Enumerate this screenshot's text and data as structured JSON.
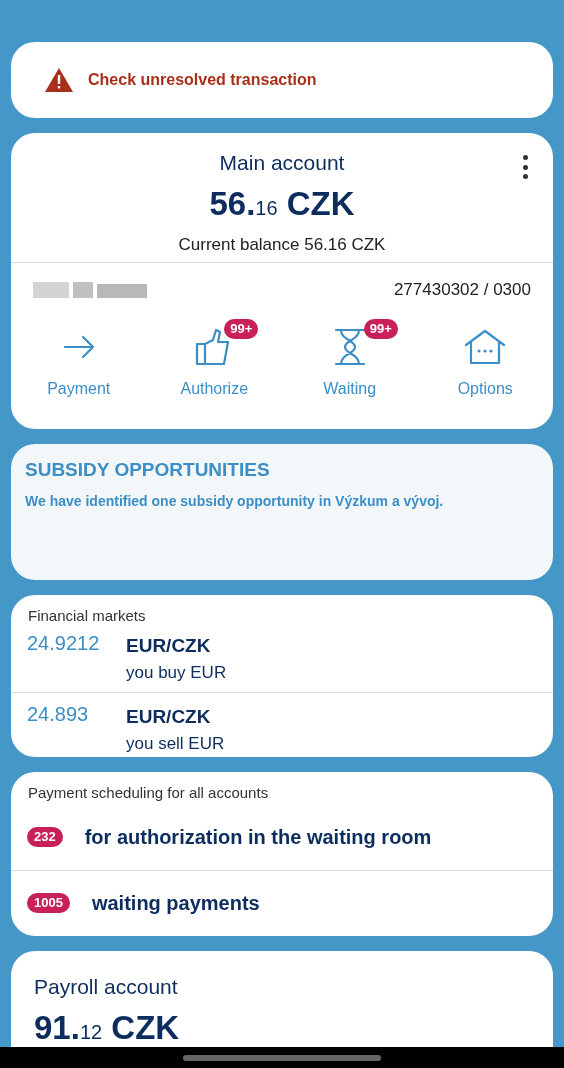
{
  "alert": {
    "text": "Check unresolved transaction"
  },
  "main_account": {
    "name": "Main account",
    "amount": {
      "whole": "56.",
      "fraction": "16",
      "currency": "CZK"
    },
    "balance": "Current balance 56.16 CZK",
    "number": "277430302 / 0300",
    "actions": [
      {
        "kind": "arrow",
        "label": "Payment"
      },
      {
        "kind": "thumb",
        "label": "Authorize",
        "badge": "99+"
      },
      {
        "kind": "hourglass",
        "label": "Waiting",
        "badge": "99+"
      },
      {
        "kind": "house",
        "label": "Options"
      }
    ]
  },
  "subsidy": {
    "title": "SUBSIDY OPPORTUNITIES",
    "text": "We have identified one subsidy opportunity in Výzkum a vývoj."
  },
  "financial_markets": {
    "title": "Financial markets",
    "rates": [
      {
        "rate": "24.9212",
        "pair": "EUR/CZK",
        "note": "you buy EUR"
      },
      {
        "rate": "24.893",
        "pair": "EUR/CZK",
        "note": "you sell EUR"
      }
    ]
  },
  "payment_scheduling": {
    "title": "Payment scheduling for all accounts",
    "items": [
      {
        "count": "232",
        "text": "for authorization in the waiting room"
      },
      {
        "count": "1005",
        "text": "waiting payments"
      }
    ]
  },
  "payroll_account": {
    "name": "Payroll account",
    "amount": {
      "whole": "91.",
      "fraction": "12",
      "currency": "CZK"
    }
  }
}
